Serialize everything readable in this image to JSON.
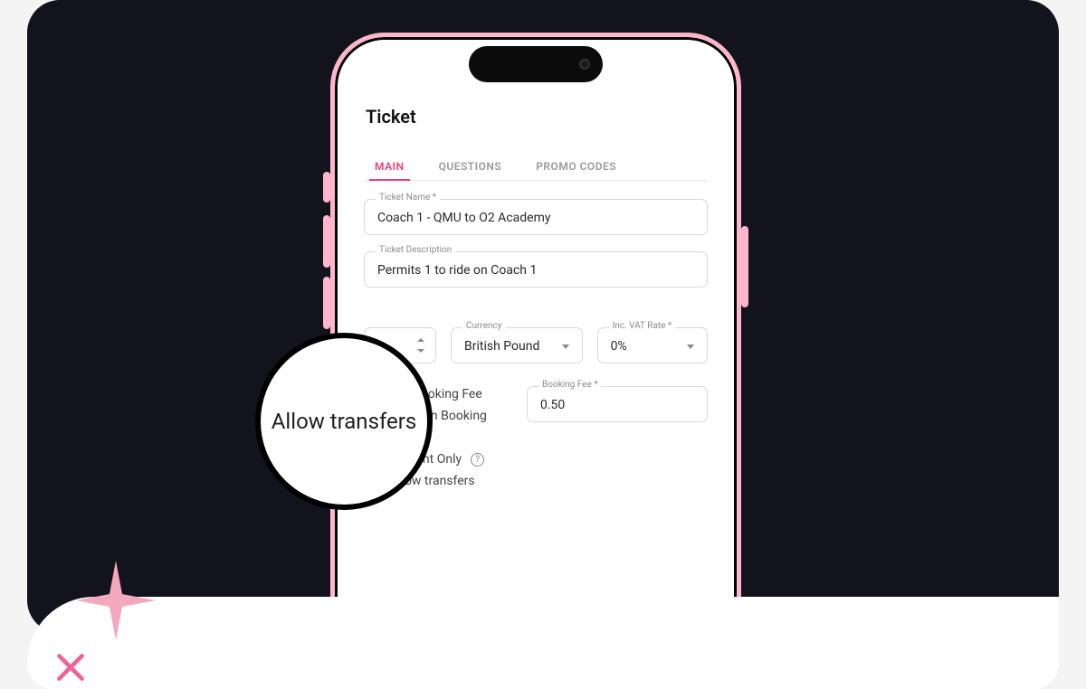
{
  "page": {
    "title": "Ticket"
  },
  "tabs": [
    {
      "label": "MAIN",
      "active": true
    },
    {
      "label": "QUESTIONS",
      "active": false
    },
    {
      "label": "PROMO CODES",
      "active": false
    }
  ],
  "fields": {
    "ticket_name": {
      "label": "Ticket Name *",
      "value": "Coach 1 - QMU to O2 Academy"
    },
    "ticket_description": {
      "label": "Ticket Description",
      "value": "Permits 1 to ride on Coach 1"
    },
    "currency": {
      "label": "Currency",
      "value": "British Pound"
    },
    "vat_rate": {
      "label": "Inc. VAT Rate *",
      "value": "0%"
    },
    "booking_fee": {
      "label": "Booking Fee *",
      "value": "0.50"
    }
  },
  "radios": {
    "absorb": {
      "label": "orb Booking Fee",
      "selected": false
    },
    "pass_on": {
      "label": "Pass On Booking Fee",
      "selected": true
    }
  },
  "checks": {
    "student_only": {
      "label": "Student Only"
    },
    "allow_transfers": {
      "label": "Allow transfers"
    }
  },
  "magnifier_text": "Allow transfers",
  "decor": {
    "sparkle_color": "#f3a8bd",
    "x_color": "#f06292"
  }
}
